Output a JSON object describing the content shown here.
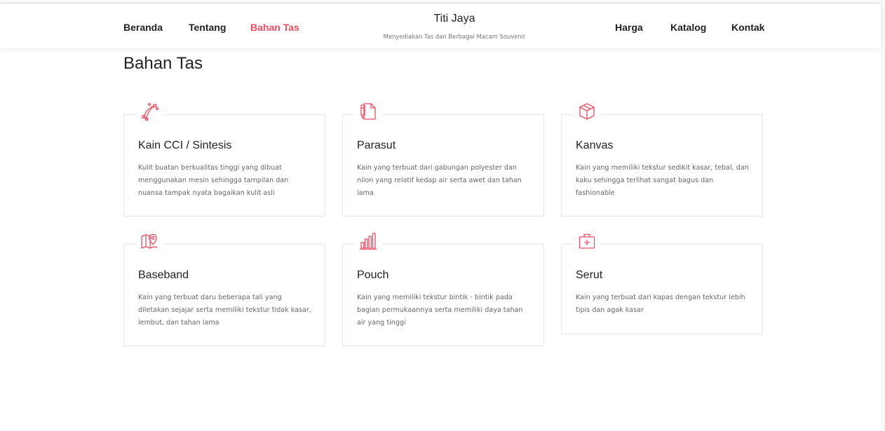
{
  "nav": {
    "left": [
      "Beranda",
      "Tentang",
      "Bahan Tas"
    ],
    "right": [
      "Harga",
      "Katalog",
      "Kontak"
    ],
    "active": "Bahan Tas"
  },
  "brand": {
    "title": "Titi Jaya",
    "subtitle": "Menyediakan Tas dan Berbagai Macam Souvenir"
  },
  "section": {
    "title": "Bahan Tas"
  },
  "colors": {
    "accent": "#ef4c61",
    "text": "#222222",
    "muted": "#666666",
    "border": "#e3e6e9"
  },
  "cards": [
    {
      "icon": "vector-pen-icon",
      "title": "Kain CCI / Sintesis",
      "desc": "Kulit buatan berkualitas tinggi yang dibuat menggunakan mesin sehingga tampilan dan nuansa tampak nyata bagaikan kulit asli"
    },
    {
      "icon": "document-pencil-icon",
      "title": "Parasut",
      "desc": "Kain yang terbuat dari gabungan polyester dan nilon yang relatif kedap air serta awet dan tahan lama"
    },
    {
      "icon": "box-icon",
      "title": "Kanvas",
      "desc": "Kain yang memiliki tekstur sedikit kasar, tebal, dan kaku sehingga terlihat sangat bagus dan fashionable"
    },
    {
      "icon": "map-pin-icon",
      "title": "Baseband",
      "desc": "Kain yang terbuat daru beberapa tali yang diletakan sejajar serta memiliki tekstur tidak kasar, lembut, dan tahan lama"
    },
    {
      "icon": "bar-chart-icon",
      "title": "Pouch",
      "desc": "Kain yang memiliki tekstur bintik - bintik pada bagian permukaannya serta memiliki daya tahan air yang tinggi"
    },
    {
      "icon": "first-aid-kit-icon",
      "title": "Serut",
      "desc": "Kain yang terbuat dari kapas dengan tekstur lebih tipis dan agak kasar"
    }
  ]
}
